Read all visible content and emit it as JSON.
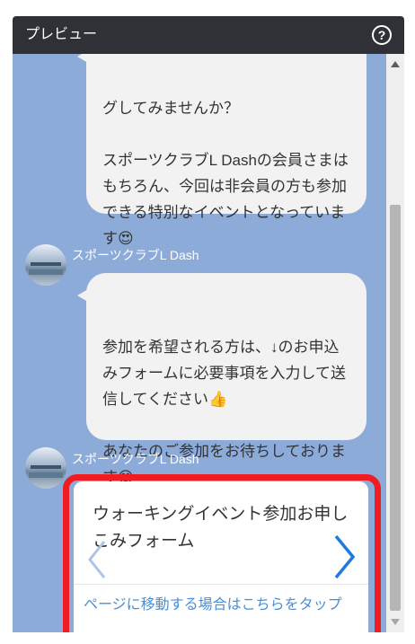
{
  "header": {
    "title": "プレビュー",
    "help_icon": "?"
  },
  "messages": [
    {
      "text": "グしてみませんか？\n\nスポーツクラブL Dashの会員さまはもちろん、今回は非会員の方も参加できる特別なイベントとなっています😍"
    },
    {
      "sender": "スポーツクラブL Dash",
      "text": "参加を希望される方は、↓のお申込みフォームに必要事項を入力して送信してください👍\n\nあなたのご参加をお待ちしております😄"
    },
    {
      "sender": "スポーツクラブL Dash",
      "card": {
        "title": "ウォーキングイベント参加お申しこみフォーム",
        "link": "ページに移動する場合はこちらをタップ"
      }
    }
  ],
  "colors": {
    "chat_background": "#8cabd9",
    "highlight": "#ef1c24",
    "link": "#4a8fd6",
    "header": "#2f3136"
  }
}
